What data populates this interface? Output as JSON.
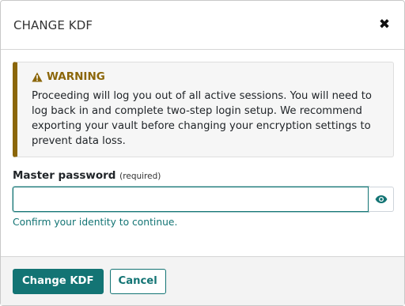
{
  "dialog": {
    "title": "CHANGE KDF",
    "close_icon": "close-icon"
  },
  "warning": {
    "icon": "warning-triangle-icon",
    "title": "WARNING",
    "text": "Proceeding will log you out of all active sessions. You will need to log back in and complete two-step login setup. We recommend exporting your vault before changing your encryption settings to prevent data loss."
  },
  "form": {
    "label": "Master password",
    "required": "(required)",
    "value": "",
    "placeholder": "",
    "toggle_icon": "eye-icon",
    "helper": "Confirm your identity to continue."
  },
  "footer": {
    "submit_label": "Change KDF",
    "cancel_label": "Cancel"
  },
  "colors": {
    "accent": "#137474",
    "warning": "#8b6609"
  }
}
